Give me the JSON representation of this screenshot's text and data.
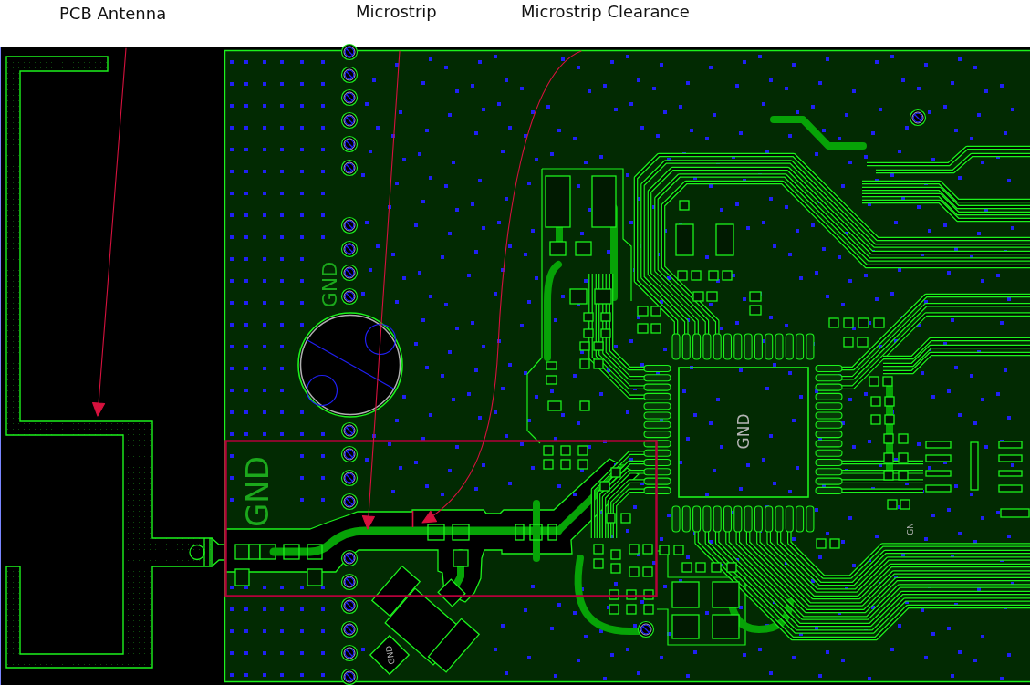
{
  "callouts": [
    {
      "label": "PCB Antenna",
      "kind": "straight"
    },
    {
      "label": "Microstrip",
      "kind": "straight"
    },
    {
      "label": "Microstrip Clearance",
      "kind": "curved"
    }
  ],
  "board_labels": [
    {
      "text": "GND",
      "kind": "copper"
    },
    {
      "text": "GND",
      "kind": "copper"
    },
    {
      "text": "GND",
      "kind": "silk"
    },
    {
      "text": "GND",
      "kind": "silk"
    },
    {
      "text": "GN",
      "kind": "silk"
    }
  ]
}
